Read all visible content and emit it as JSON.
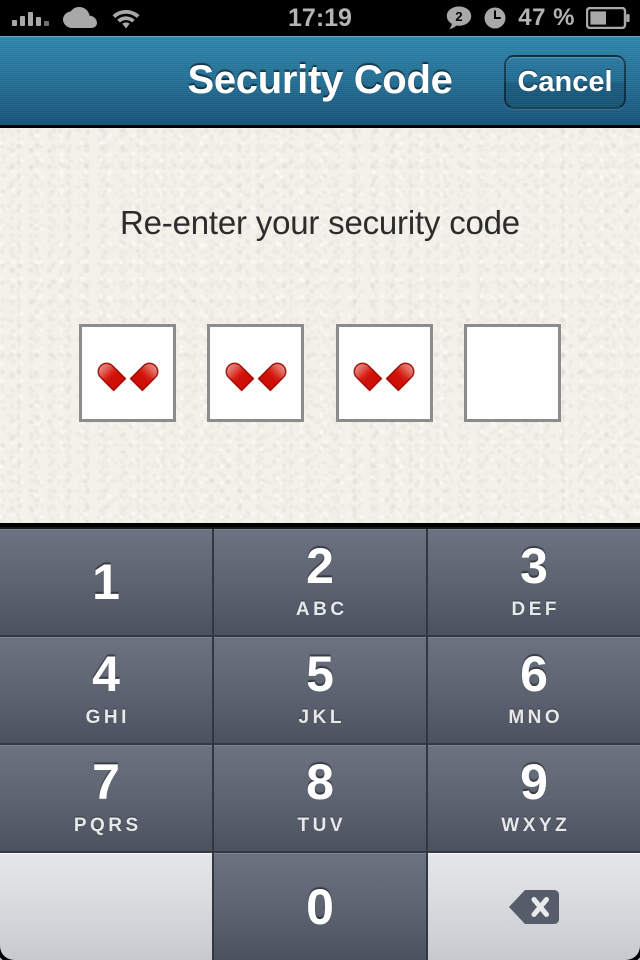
{
  "status_bar": {
    "time": "17:19",
    "battery_percent": "47 %",
    "battery_level": 47,
    "signal_icon": "signal-bars-icon",
    "cloud_icon": "cloud-icon",
    "wifi_icon": "wifi-icon",
    "messages_badge": "2",
    "messages_icon": "speech-bubble-icon",
    "alarm_icon": "alarm-clock-icon",
    "battery_icon": "battery-icon"
  },
  "navbar": {
    "title": "Security Code",
    "cancel_label": "Cancel",
    "background_color": "#236d93"
  },
  "content": {
    "prompt": "Re-enter your security code",
    "background_color": "#f3f1e9",
    "code_boxes": [
      {
        "filled": true,
        "glyph": "heart-icon"
      },
      {
        "filled": true,
        "glyph": "heart-icon"
      },
      {
        "filled": true,
        "glyph": "heart-icon"
      },
      {
        "filled": false,
        "glyph": ""
      }
    ],
    "entered_count": 3,
    "total_count": 4,
    "heart_color": "#d2150c"
  },
  "keypad": {
    "key_color": "#5c6270",
    "light_key_color": "#d6d9dd",
    "rows": [
      [
        {
          "digit": "1",
          "letters": "",
          "type": "digit"
        },
        {
          "digit": "2",
          "letters": "ABC",
          "type": "digit"
        },
        {
          "digit": "3",
          "letters": "DEF",
          "type": "digit"
        }
      ],
      [
        {
          "digit": "4",
          "letters": "GHI",
          "type": "digit"
        },
        {
          "digit": "5",
          "letters": "JKL",
          "type": "digit"
        },
        {
          "digit": "6",
          "letters": "MNO",
          "type": "digit"
        }
      ],
      [
        {
          "digit": "7",
          "letters": "PQRS",
          "type": "digit"
        },
        {
          "digit": "8",
          "letters": "TUV",
          "type": "digit"
        },
        {
          "digit": "9",
          "letters": "WXYZ",
          "type": "digit"
        }
      ],
      [
        {
          "digit": "",
          "letters": "",
          "type": "blank"
        },
        {
          "digit": "0",
          "letters": "",
          "type": "digit"
        },
        {
          "digit": "",
          "letters": "",
          "type": "delete",
          "icon": "backspace-icon"
        }
      ]
    ]
  }
}
